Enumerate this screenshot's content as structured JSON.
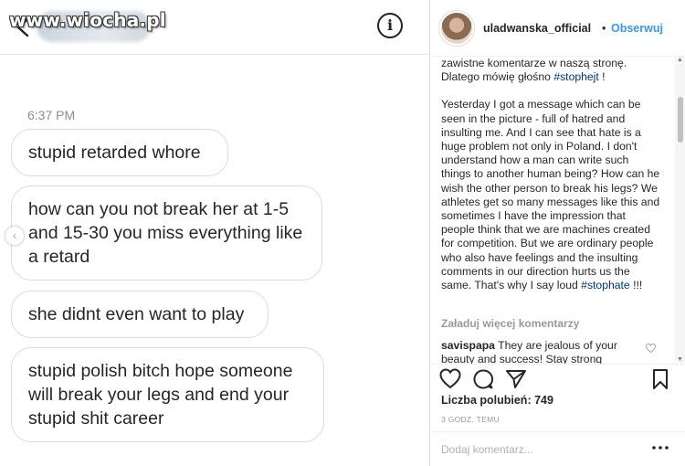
{
  "watermark": "www.wiocha.pl",
  "dm": {
    "info_icon": "info-icon",
    "timestamp": "6:37 PM",
    "messages": [
      "stupid retarded whore",
      "how can you not break her at 1-5 and 15-30 you miss everything like a retard",
      "she didnt even want to play",
      "stupid polish bitch hope someone will break your legs and end your stupid shit career"
    ]
  },
  "post": {
    "username": "uladwanska_official",
    "dot": "•",
    "follow": "Obserwuj",
    "caption_pl_tail": "zawistne komentarze w naszą stronę. Dlatego mówię głośno",
    "hashtag_pl": "#stophejt",
    "caption_pl_end": " !",
    "caption_en": "Yesterday I got a message which can be seen in the picture - full of hatred and insulting me. And I can see that hate is a huge problem not only in Poland. I don't understand how a man can write such things to another human being? How can he wish the other person to break his legs? We athletes get so many messages like this and sometimes I have the impression that people think that we are machines created for competition. But we are ordinary people who also have feelings and the insulting comments in our direction hurts us the same. That's why I say loud",
    "hashtag_en": "#stophate",
    "caption_en_end": " !!!",
    "load_more": "Załaduj więcej komentarzy",
    "comment_user": "savispapa",
    "comment_text": "They are jealous of your beauty and success! Stay strong",
    "likes_label": "Liczba polubień: 749",
    "time_ago": "3 GODZ. TEMU",
    "add_comment_placeholder": "Dodaj komentarz...",
    "accent": "#3897f0"
  }
}
